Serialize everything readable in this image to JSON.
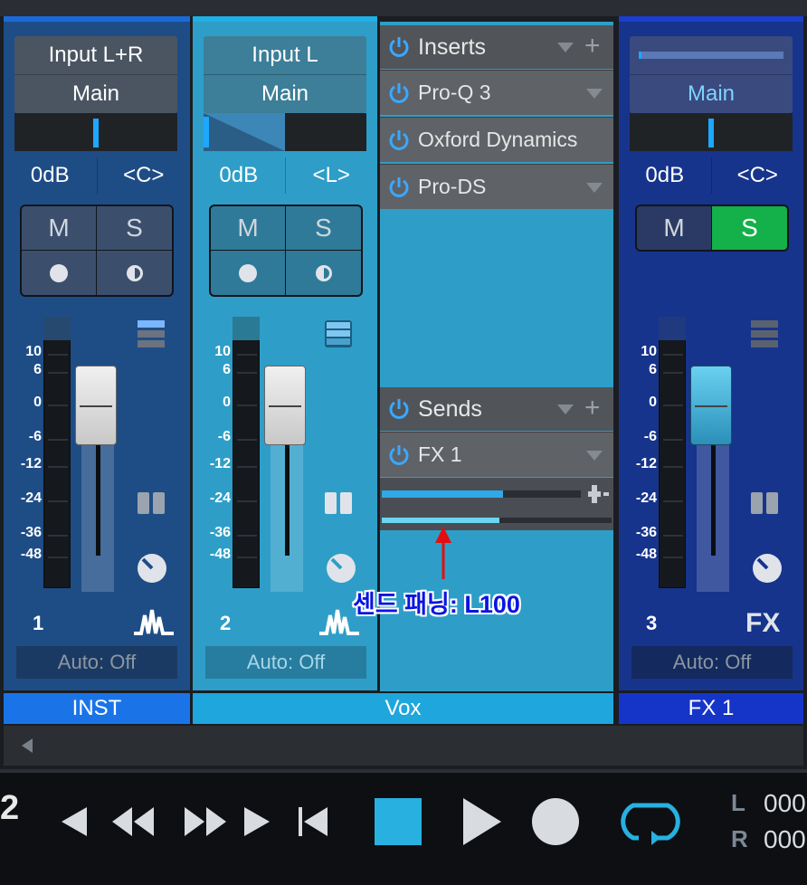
{
  "channels": {
    "inst": {
      "input": "Input L+R",
      "output": "Main",
      "volume": "0dB",
      "pan": "<C>",
      "mute": "M",
      "solo": "S",
      "number": "1",
      "automation": "Auto: Off",
      "label": "INST"
    },
    "vox": {
      "input": "Input L",
      "output": "Main",
      "volume": "0dB",
      "pan": "<L>",
      "mute": "M",
      "solo": "S",
      "number": "2",
      "automation": "Auto: Off",
      "label": "Vox"
    },
    "fx": {
      "output": "Main",
      "volume": "0dB",
      "pan": "<C>",
      "mute": "M",
      "solo": "S",
      "number": "3",
      "badge": "FX",
      "automation": "Auto: Off",
      "label": "FX 1"
    }
  },
  "scale": [
    "10",
    "6",
    "0",
    "-6",
    "-12",
    "-24",
    "-36",
    "-48"
  ],
  "inserts": {
    "title": "Inserts",
    "items": [
      "Pro-Q 3",
      "Oxford Dynamics",
      "Pro-DS"
    ]
  },
  "sends": {
    "title": "Sends",
    "items": [
      "FX 1"
    ]
  },
  "annotation": "센드 패닝: L100",
  "transport": {
    "counter": "2",
    "l_label": "L",
    "l_value": "000",
    "r_label": "R",
    "r_value": "000"
  },
  "colors": {
    "accent": "#1fb0e6",
    "solo_active": "#14b04a",
    "annotation_arrow": "#e01010"
  }
}
